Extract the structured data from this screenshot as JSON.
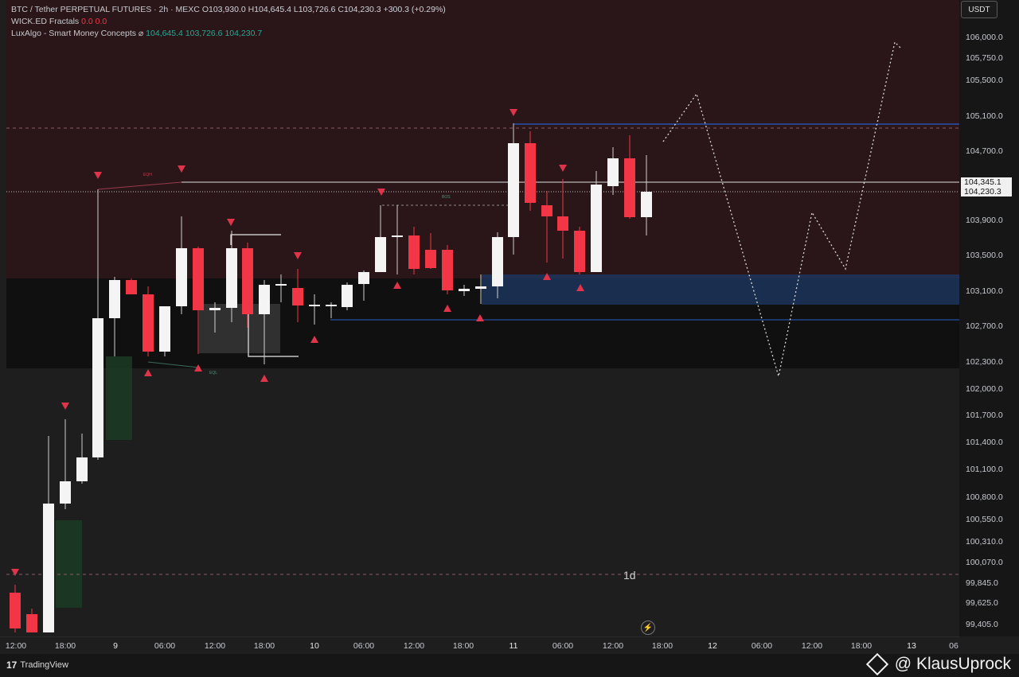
{
  "legend": {
    "symbol": "BTC / Tether PERPETUAL FUTURES · 2h · MEXC",
    "o_label": "O",
    "o": "103,930.0",
    "h_label": "H",
    "h": "104,645.4",
    "l_label": "L",
    "l": "103,726.6",
    "c_label": "C",
    "c": "104,230.3",
    "change": "+300.3 (+0.29%)",
    "ind1_name": "WICK.ED Fractals",
    "ind1_v1": "0.0",
    "ind1_v2": "0.0",
    "ind2_name": "LuxAlgo - Smart Money Concepts",
    "ind2_icon": "eye-slash-icon",
    "ind2_v1": "104,645.4",
    "ind2_v2": "103,726.6",
    "ind2_v3": "104,230.7"
  },
  "price_axis": {
    "currency": "USDT",
    "ticks": [
      "106,000.0",
      "105,750.0",
      "105,500.0",
      "105,100.0",
      "104,700.0",
      "103,900.0",
      "103,500.0",
      "103,100.0",
      "102,700.0",
      "102,300.0",
      "102,000.0",
      "101,700.0",
      "101,400.0",
      "101,100.0",
      "100,800.0",
      "100,550.0",
      "100,310.0",
      "100,070.0",
      "99,845.0",
      "99,625.0",
      "99,405.0"
    ],
    "label_1": "104,345.1",
    "label_2": "104,230.3"
  },
  "time_axis": {
    "ticks": [
      "12:00",
      "18:00",
      "9",
      "06:00",
      "12:00",
      "18:00",
      "10",
      "06:00",
      "12:00",
      "18:00",
      "11",
      "06:00",
      "12:00",
      "18:00",
      "12",
      "06:00",
      "12:00",
      "18:00",
      "13",
      "06"
    ]
  },
  "annotations": {
    "eqh": "EQH",
    "eql": "EQL",
    "bos": "BOS",
    "timeframe": "1d"
  },
  "footer": {
    "brand": "TradingView",
    "brand_mark": "17",
    "watermark": "@ KlausUprock"
  },
  "colors": {
    "bull": "#f4f4f4",
    "bear": "#f23645",
    "premium_zone": "#2a1618",
    "discount_zone": "#101010",
    "order_block": "#1e3a66",
    "fvg": "#1b3a24",
    "bg": "#1e1e1e"
  }
}
